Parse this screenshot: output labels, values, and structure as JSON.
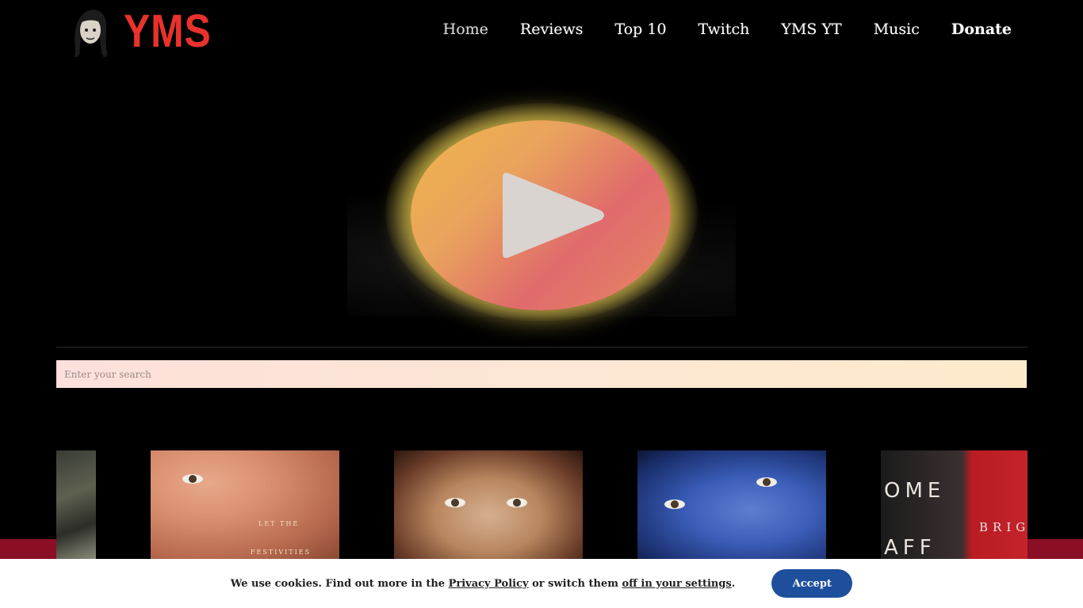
{
  "brand": {
    "logo_text": "YMS",
    "accent": "#e8322b"
  },
  "nav": {
    "items": [
      {
        "label": "Home"
      },
      {
        "label": "Reviews"
      },
      {
        "label": "Top 10"
      },
      {
        "label": "Twitch"
      },
      {
        "label": "YMS YT"
      },
      {
        "label": "Music"
      },
      {
        "label": "Donate"
      }
    ]
  },
  "video": {
    "icon": "play-icon"
  },
  "search": {
    "placeholder": "Enter your search"
  },
  "posters": {
    "p2_caption_1": "LET THE",
    "p2_caption_2": "FESTIVITIES",
    "p5_big": "OME",
    "p5_big_2": "AFF",
    "p5_side": "BRIG"
  },
  "cookie": {
    "text_1": "We use cookies. Find out more in the ",
    "privacy_link": "Privacy Policy",
    "text_2": " or switch them ",
    "settings_link": "off in your settings",
    "text_3": ".",
    "accept_label": "Accept",
    "accept_color": "#1e4f9c"
  }
}
